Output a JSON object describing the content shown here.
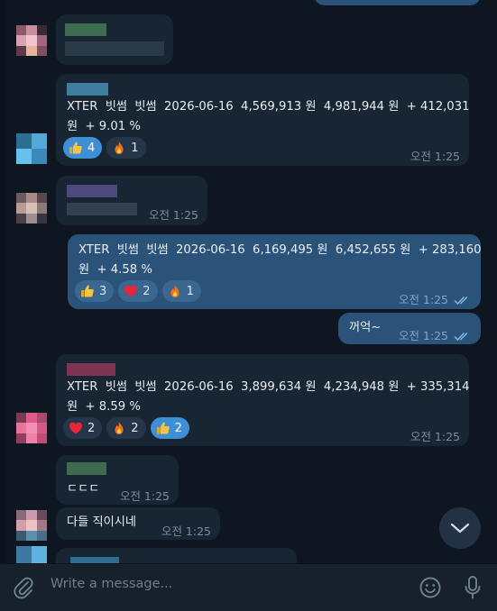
{
  "composer": {
    "placeholder": "Write a message...",
    "attach_icon": "paperclip-icon",
    "emoji_icon": "smile-icon",
    "mic_icon": "microphone-icon"
  },
  "scroll_down_icon": "chevron-down-icon",
  "messages": [
    {
      "dir": "in",
      "text": ""
    },
    {
      "dir": "in",
      "text": "XTER  빗썸  빗썸  2026-06-16  4,569,913 원  4,981,944 원  + 412,031\n원  + 9.01 %",
      "time": "오전 1:25",
      "reactions": [
        {
          "emoji": "thumbs-up",
          "count": "4",
          "selected": true
        },
        {
          "emoji": "fire",
          "count": "1",
          "selected": false
        }
      ]
    },
    {
      "dir": "in",
      "text": "",
      "time": "오전 1:25"
    },
    {
      "dir": "out",
      "text": "XTER  빗썸  빗썸  2026-06-16  6,169,495 원  6,452,655 원  + 283,160\n원  + 4.58 %",
      "time": "오전 1:25",
      "reactions": [
        {
          "emoji": "thumbs-up",
          "count": "3",
          "selected": false
        },
        {
          "emoji": "heart",
          "count": "2",
          "selected": false
        },
        {
          "emoji": "fire",
          "count": "1",
          "selected": false
        }
      ]
    },
    {
      "dir": "out",
      "text": "꺼억~",
      "time": "오전 1:25"
    },
    {
      "dir": "in",
      "text": "XTER  빗썸  빗썸  2026-06-16  3,899,634 원  4,234,948 원  + 335,314\n원  + 8.59 %",
      "time": "오전 1:25",
      "reactions": [
        {
          "emoji": "heart",
          "count": "2",
          "selected": false
        },
        {
          "emoji": "fire",
          "count": "2",
          "selected": false
        },
        {
          "emoji": "thumbs-up",
          "count": "2",
          "selected": true
        }
      ]
    },
    {
      "dir": "in",
      "text": "ㄷㄷㄷ",
      "time": "오전 1:25"
    },
    {
      "dir": "in",
      "text": "다들 직이시네",
      "time": "오전 1:25"
    }
  ]
}
